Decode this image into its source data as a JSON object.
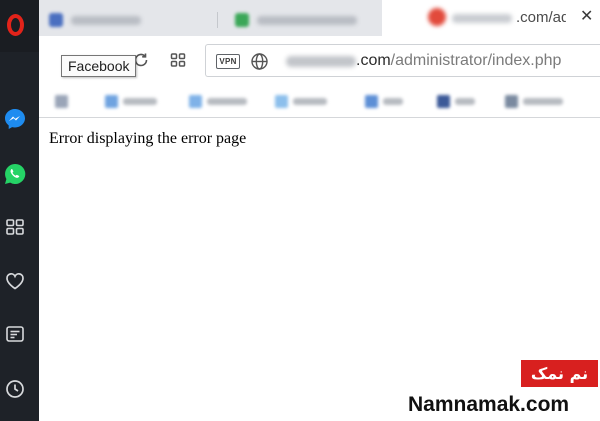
{
  "browser": {
    "active_tab": {
      "title": ".com/adr",
      "close_glyph": "✕"
    },
    "toolbar": {
      "tooltip": "Facebook",
      "vpn_label": "VPN",
      "url_domain_suffix": ".com",
      "url_path": "/administrator/index.php"
    }
  },
  "sidebar": {
    "items": [
      {
        "icon": "opera-logo-icon"
      },
      {
        "icon": "messenger-icon"
      },
      {
        "icon": "whatsapp-icon"
      },
      {
        "icon": "grid-icon"
      },
      {
        "icon": "heart-icon"
      },
      {
        "icon": "news-icon"
      },
      {
        "icon": "history-icon"
      }
    ]
  },
  "page": {
    "error_message": "Error displaying the error page"
  },
  "watermark": {
    "badge_text": "نم نمک",
    "site": "Namnamak.com"
  },
  "colors": {
    "opera_red": "#e2231a",
    "messenger_blue": "#1e8cf0",
    "whatsapp_green": "#25d366",
    "sidebar_bg": "#1e2228",
    "watermark_red": "#d8201f"
  }
}
